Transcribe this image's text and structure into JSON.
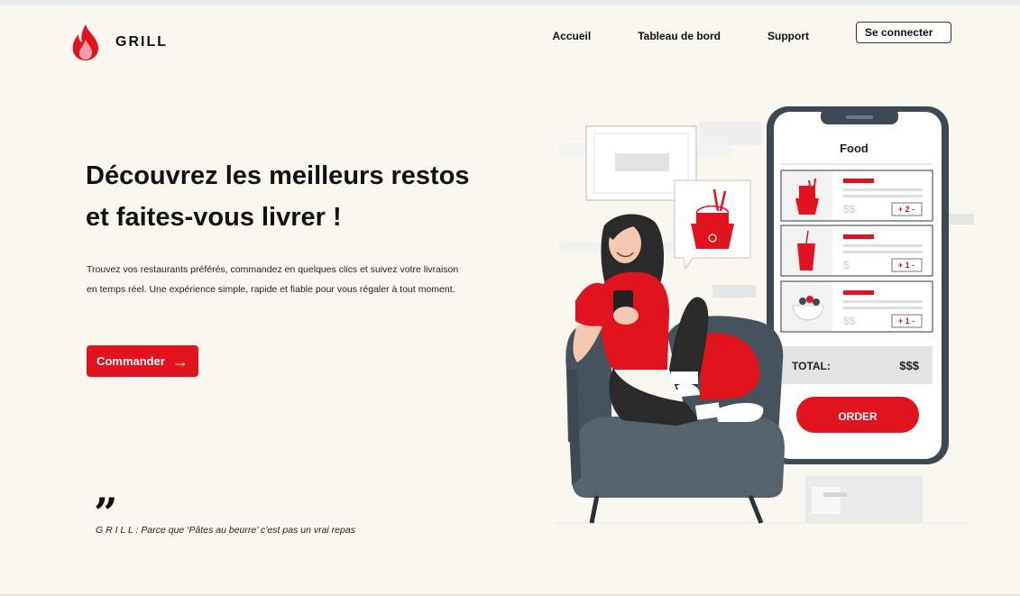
{
  "header": {
    "brand": "GRILL",
    "nav": [
      "Accueil",
      "Tableau de bord",
      "Support"
    ],
    "login_label": "Se connecter"
  },
  "hero": {
    "title_line1": "Découvrez les meilleurs restos",
    "title_line2": "et faites-vous livrer !",
    "text_line1": "Trouvez vos restaurants préférés, commandez en quelques clics et suivez votre livraison",
    "text_line2": "en temps réel. Une expérience simple, rapide et fiable pour vous régaler à tout moment.",
    "cta_label": "Commander"
  },
  "quote": {
    "mark": "”",
    "text": "G R I L L : Parce que ‘Pâtes au beurre’ c’est pas un vrai repas"
  },
  "phone": {
    "title": "Food",
    "items": [
      {
        "price": "$$",
        "qty": "+ 2 -"
      },
      {
        "price": "$",
        "qty": "+ 1 -"
      },
      {
        "price": "$$",
        "qty": "+ 1 -"
      }
    ],
    "total_label": "TOTAL:",
    "total_value": "$$$",
    "order_label": "ORDER"
  },
  "colors": {
    "accent": "#e1131e",
    "background": "#faf7f1",
    "chair": "#46525c"
  }
}
